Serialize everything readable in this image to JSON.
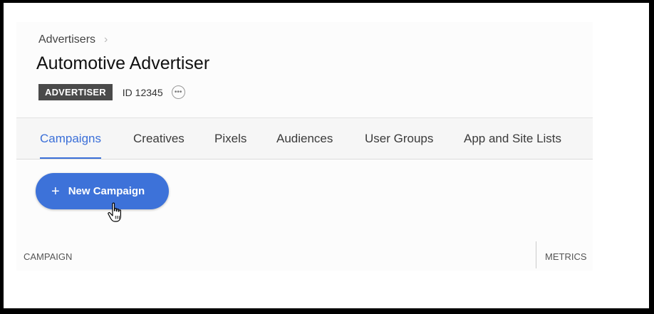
{
  "breadcrumb": {
    "label": "Advertisers",
    "separator": "›"
  },
  "advertiser": {
    "name": "Automotive Advertiser",
    "badge": "ADVERTISER",
    "id_label": "ID 12345",
    "more_icon": "ellipsis-circle-icon"
  },
  "tabs": [
    {
      "label": "Campaigns",
      "active": true
    },
    {
      "label": "Creatives",
      "active": false
    },
    {
      "label": "Pixels",
      "active": false
    },
    {
      "label": "Audiences",
      "active": false
    },
    {
      "label": "User Groups",
      "active": false
    },
    {
      "label": "App and Site Lists",
      "active": false
    }
  ],
  "actions": {
    "new_campaign_label": "New Campaign",
    "new_campaign_icon": "plus-icon"
  },
  "table": {
    "columns": [
      "CAMPAIGN",
      "METRICS"
    ]
  },
  "colors": {
    "accent": "#3d72d9",
    "badge_bg": "#4a4a4a"
  }
}
